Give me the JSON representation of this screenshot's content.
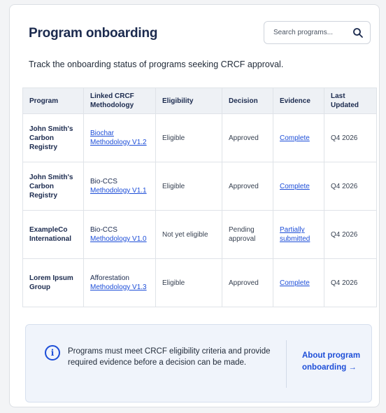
{
  "header": {
    "title": "Program onboarding",
    "search_placeholder": "Search programs...",
    "description": "Track the onboarding status of programs seeking CRCF approval."
  },
  "table": {
    "columns": [
      "Program",
      "Linked CRCF Methodology",
      "Eligibility",
      "Decision",
      "Evidence",
      "Last Updated"
    ],
    "rows": [
      {
        "program": "John Smith's Carbon Registry",
        "methodology": "Biochar Methodology V1.2",
        "methodology_linked": true,
        "eligibility": "Eligible",
        "decision": "Approved",
        "evidence": "Complete",
        "updated": "Q4 2026"
      },
      {
        "program": "John Smith's Carbon Registry",
        "methodology": "Bio-CCS Methodology V1.1",
        "methodology_linked": false,
        "eligibility": "Eligible",
        "decision": "Approved",
        "evidence": "Complete",
        "updated": "Q4 2026"
      },
      {
        "program": "ExampleCo International",
        "methodology": "Bio-CCS Methodology V1.0",
        "methodology_linked": false,
        "eligibility": "Not yet eligible",
        "decision": "Pending approval",
        "evidence": "Partially submitted",
        "updated": "Q4 2026"
      },
      {
        "program": "Lorem Ipsum Group",
        "methodology": "Afforestation Methodology V1.3",
        "methodology_linked": false,
        "eligibility": "Eligible",
        "decision": "Approved",
        "evidence": "Complete",
        "updated": "Q4 2026"
      }
    ]
  },
  "info": {
    "icon": "info-icon",
    "text": "Programs must meet CRCF eligibility criteria and provide required evidence before a decision can be made.",
    "link": "About program onboarding →"
  },
  "colors": {
    "heading": "#1b2a4e",
    "link": "#1d4ed8",
    "header_row_bg": "#eef1f5",
    "info_bg": "#f0f4fb"
  }
}
